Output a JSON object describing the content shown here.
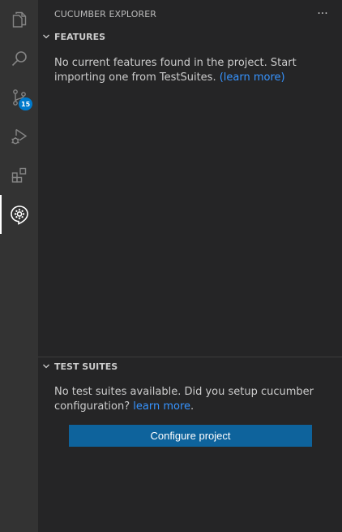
{
  "activity_bar": {
    "items": [
      {
        "name": "explorer-icon"
      },
      {
        "name": "search-icon"
      },
      {
        "name": "source-control-icon",
        "badge": "15"
      },
      {
        "name": "run-debug-icon"
      },
      {
        "name": "extensions-icon"
      },
      {
        "name": "cucumber-icon",
        "active": true
      }
    ]
  },
  "sidebar": {
    "title": "CUCUMBER EXPLORER",
    "more_label": "···"
  },
  "features": {
    "label": "FEATURES",
    "message": "No current features found in the project. Start importing one from TestSuites. ",
    "link": "(learn more)"
  },
  "test_suites": {
    "label": "TEST SUITES",
    "message": "No test suites available. Did you setup cucumber configuration? ",
    "link": "learn more",
    "suffix": ".",
    "button_label": "Configure project"
  },
  "colors": {
    "activity_bar": "#333333",
    "sidebar": "#252526",
    "button": "#0e639c",
    "link": "#3794ff",
    "badge": "#007acc"
  }
}
